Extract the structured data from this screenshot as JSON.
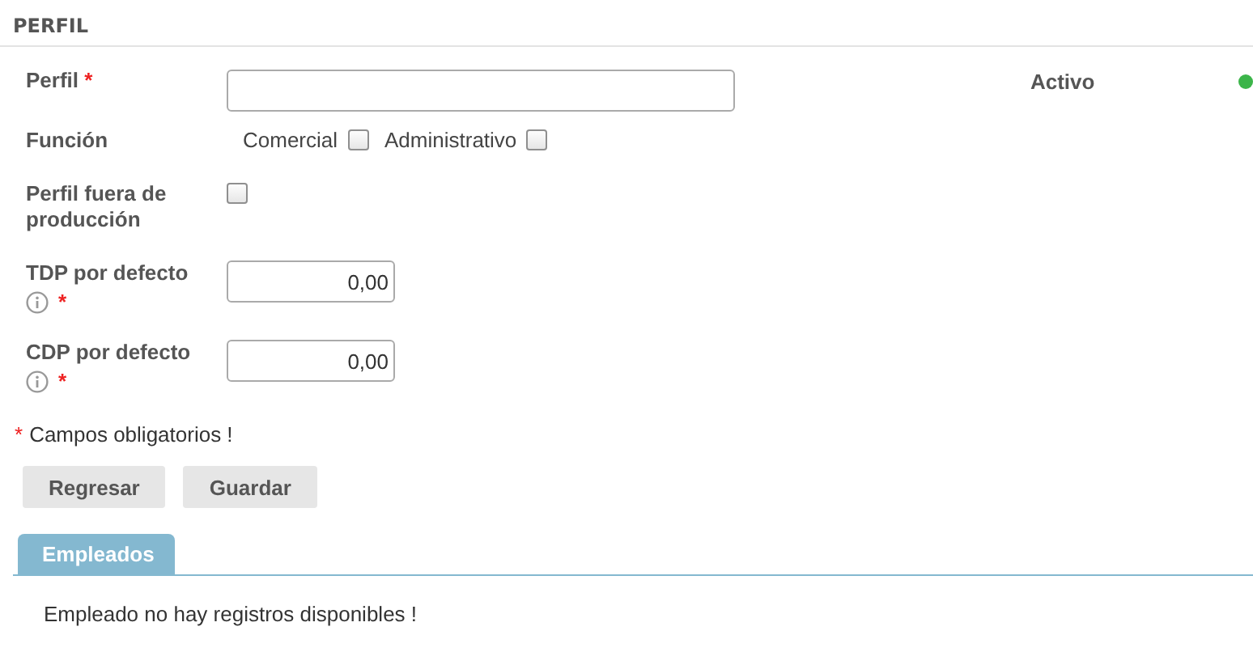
{
  "section": {
    "title": "PERFIL"
  },
  "status": {
    "label": "Activo",
    "active": true
  },
  "fields": [
    {
      "kind": "text",
      "label": "Perfil",
      "required_mark": "*"
    },
    {
      "kind": "checks",
      "label": "Función",
      "options": [
        {
          "label": "Comercial",
          "checked": false
        },
        {
          "label": "Administrativo",
          "checked": false
        }
      ]
    },
    {
      "kind": "checkbox",
      "label": "Perfil fuera de producción",
      "checked": false
    },
    {
      "kind": "number",
      "label": "TDP por defecto",
      "info": true,
      "required_mark": "*",
      "value": "0,00"
    },
    {
      "kind": "number",
      "label": "CDP por defecto",
      "info": true,
      "required_mark": "*",
      "value": "0,00"
    }
  ],
  "required_note": {
    "mark": "*",
    "text": "Campos obligatorios !"
  },
  "buttons": [
    "Regresar",
    "Guardar"
  ],
  "tabs": [
    {
      "label": "Empleados",
      "selected": true
    }
  ],
  "empty_message": "Empleado no hay registros disponibles !"
}
